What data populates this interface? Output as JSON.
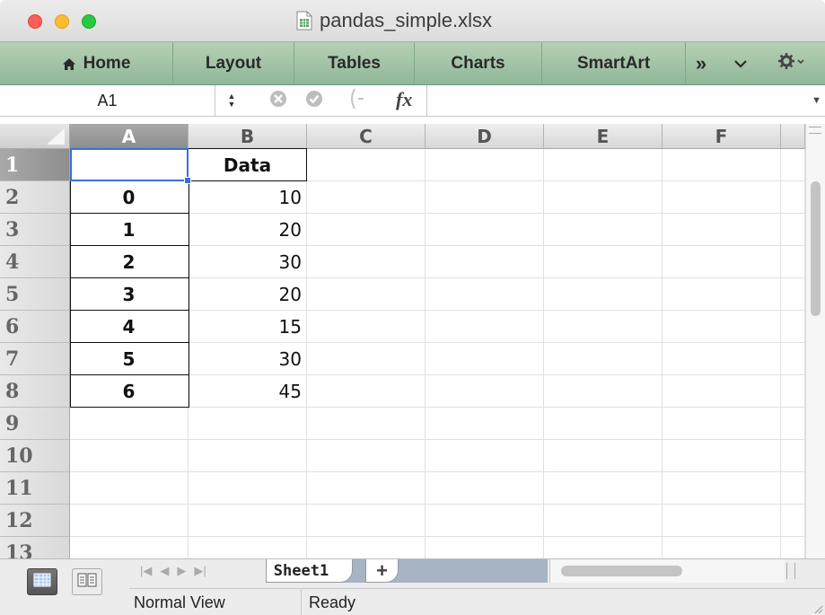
{
  "window": {
    "title": "pandas_simple.xlsx",
    "doc_icon": "spreadsheet-document-icon"
  },
  "ribbon": {
    "tabs": [
      {
        "label": "Home",
        "icon": "home-icon"
      },
      {
        "label": "Layout"
      },
      {
        "label": "Tables"
      },
      {
        "label": "Charts"
      },
      {
        "label": "SmartArt"
      }
    ],
    "overflow_label": "»",
    "collapse_icon": "chevron-down-icon",
    "settings_icon": "gear-icon",
    "accent": "#9dbf9f"
  },
  "formula_bar": {
    "name_box": "A1",
    "fx_label": "fx",
    "value": ""
  },
  "sheet": {
    "columns": [
      "A",
      "B",
      "C",
      "D",
      "E",
      "F"
    ],
    "selected_column": "A",
    "rows": [
      "1",
      "2",
      "3",
      "4",
      "5",
      "6",
      "7",
      "8",
      "9",
      "10",
      "11",
      "12",
      "13"
    ],
    "selected_row": "1",
    "selected_cell": "A1",
    "cells": {
      "B1": "Data",
      "A2": "0",
      "B2": "10",
      "A3": "1",
      "B3": "20",
      "A4": "2",
      "B4": "30",
      "A5": "3",
      "B5": "20",
      "A6": "4",
      "B6": "15",
      "A7": "5",
      "B7": "30",
      "A8": "6",
      "B8": "45"
    },
    "selection_color": "#3a6fd8"
  },
  "bottom": {
    "sheet_tabs": [
      "Sheet1"
    ],
    "add_sheet_label": "+",
    "view_label": "Normal View",
    "status_label": "Ready"
  }
}
